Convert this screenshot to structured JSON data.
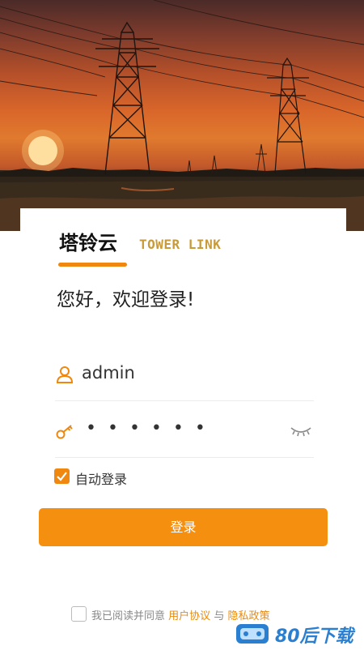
{
  "hero": {
    "icon": "power-tower-sunset-image"
  },
  "brand": {
    "name_cn": "塔铃云",
    "name_en": "TOWER LINK",
    "accent": "#f0870e"
  },
  "greeting": "您好，欢迎登录!",
  "login_form": {
    "username_icon": "user-icon",
    "username_value": "admin",
    "password_icon": "key-icon",
    "password_masked": "••••••",
    "password_toggle_icon": "eye-closed-icon",
    "auto_login_label": "自动登录",
    "auto_login_checked": true,
    "submit_label": "登录"
  },
  "agreement": {
    "prefix": "我已阅读并同意",
    "user_agreement": "用户协议",
    "conjunction": "与",
    "privacy_policy": "隐私政策",
    "checked": false
  },
  "watermark": {
    "text": "80后下载"
  },
  "colors": {
    "primary_button": "#f58f10",
    "link": "#e78b12",
    "brand_en": "#c79a3a"
  }
}
